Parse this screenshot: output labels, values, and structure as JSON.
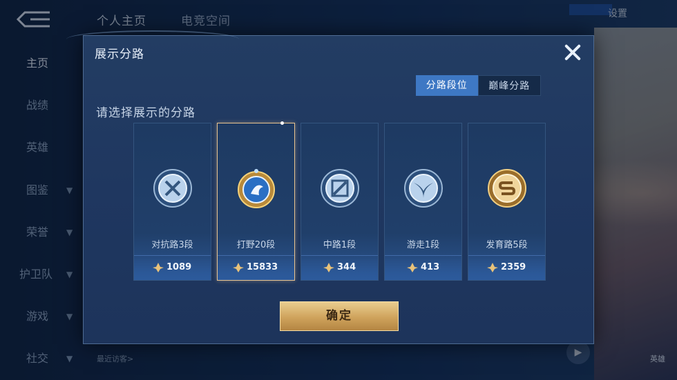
{
  "background": {
    "top_tabs": [
      "个人主页",
      "电竞空间"
    ],
    "sidebar": [
      {
        "label": "主页",
        "has_chevron": false
      },
      {
        "label": "战绩",
        "has_chevron": false
      },
      {
        "label": "英雄",
        "has_chevron": false
      },
      {
        "label": "图鉴",
        "has_chevron": true
      },
      {
        "label": "荣誉",
        "has_chevron": true
      },
      {
        "label": "护卫队",
        "has_chevron": true
      },
      {
        "label": "游戏",
        "has_chevron": true
      },
      {
        "label": "社交",
        "has_chevron": true
      }
    ],
    "settings_label": "设置",
    "visitor_label": "最近访客>",
    "hero_btn_label": "英雄"
  },
  "modal": {
    "title": "展示分路",
    "toggle": {
      "lane_rank_label": "分路段位",
      "peak_lane_label": "巅峰分路"
    },
    "prompt": "请选择展示的分路",
    "cards": [
      {
        "name": "对抗路3段",
        "score": "1089",
        "emblem": "clash-lane-emblem-icon",
        "color": "#cfe0f2",
        "selected": false
      },
      {
        "name": "打野20段",
        "score": "15833",
        "emblem": "jungle-emblem-icon",
        "color": "#f0c45c",
        "selected": true
      },
      {
        "name": "中路1段",
        "score": "344",
        "emblem": "mid-lane-emblem-icon",
        "color": "#cfe0f2",
        "selected": false
      },
      {
        "name": "游走1段",
        "score": "413",
        "emblem": "roam-emblem-icon",
        "color": "#cfe0f2",
        "selected": false
      },
      {
        "name": "发育路5段",
        "score": "2359",
        "emblem": "farm-lane-emblem-icon",
        "color": "#e8b85a",
        "selected": false
      }
    ],
    "confirm_label": "确定"
  },
  "colors": {
    "modal_bg": "#233d63",
    "accent_blue": "#3e78c4",
    "gold": "#e9c48f"
  }
}
